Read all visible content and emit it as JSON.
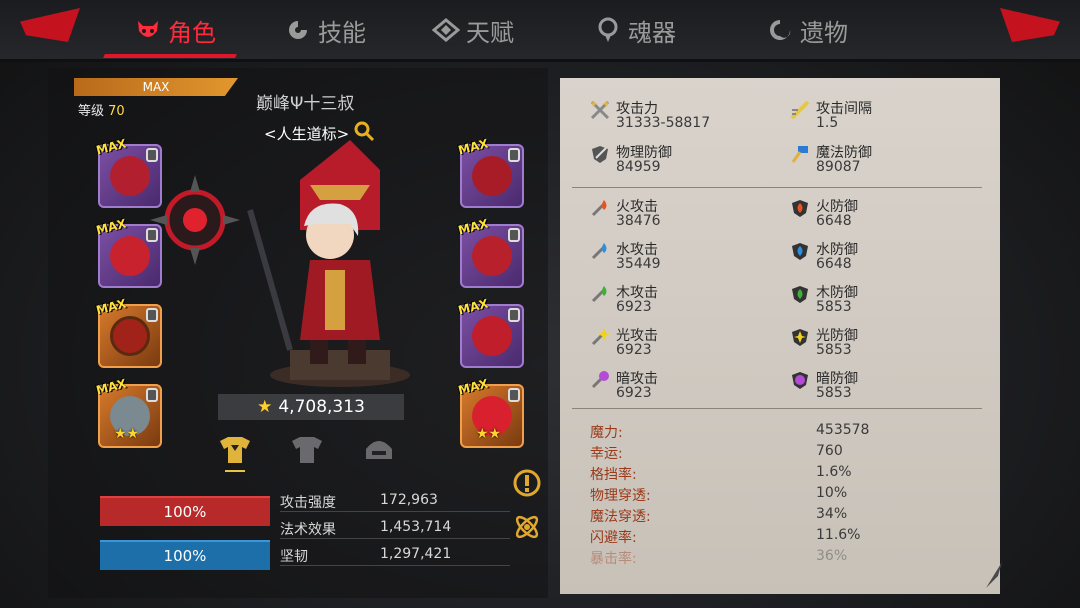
{
  "tabs": [
    {
      "label": "角色",
      "icon": "devil-face-icon",
      "active": true
    },
    {
      "label": "技能",
      "icon": "spiral-skill-icon",
      "active": false
    },
    {
      "label": "天赋",
      "icon": "diamond-talent-icon",
      "active": false
    },
    {
      "label": "魂器",
      "icon": "soul-vessel-icon",
      "active": false
    },
    {
      "label": "遗物",
      "icon": "relic-swirl-icon",
      "active": false
    }
  ],
  "character": {
    "max_label": "MAX",
    "level_label": "等级",
    "level_value": "70",
    "name": "巅峰Ψ十三叔",
    "title": "<人生道标>",
    "power": "4,708,313"
  },
  "equipment": {
    "max_tag": "MAX",
    "left": [
      {
        "name": "weapon-slot",
        "stars": ""
      },
      {
        "name": "glove-slot",
        "stars": ""
      },
      {
        "name": "ring-slot",
        "stars": ""
      },
      {
        "name": "robot-pet-slot",
        "stars": "★★"
      }
    ],
    "right": [
      {
        "name": "helmet-slot",
        "stars": ""
      },
      {
        "name": "armor-slot",
        "stars": ""
      },
      {
        "name": "boots-slot",
        "stars": ""
      },
      {
        "name": "shard-slot",
        "stars": "★★"
      }
    ]
  },
  "bars": {
    "hp": "100%",
    "mp": "100%"
  },
  "substats": [
    {
      "label": "攻击强度",
      "value": "172,963"
    },
    {
      "label": "法术效果",
      "value": "1,453,714"
    },
    {
      "label": "坚韧",
      "value": "1,297,421"
    }
  ],
  "stats_main": [
    {
      "label": "攻击力",
      "value": "31333-58817",
      "icon": "swords-icon"
    },
    {
      "label": "攻击间隔",
      "value": "1.5",
      "icon": "speed-sword-icon"
    },
    {
      "label": "物理防御",
      "value": "84959",
      "icon": "shield-sword-icon"
    },
    {
      "label": "魔法防御",
      "value": "89087",
      "icon": "magic-hammer-icon"
    }
  ],
  "stats_element": [
    {
      "label": "火攻击",
      "value": "38476",
      "color": "#e8531f"
    },
    {
      "label": "火防御",
      "value": "6648",
      "color": "#e8531f"
    },
    {
      "label": "水攻击",
      "value": "35449",
      "color": "#2e8fe0"
    },
    {
      "label": "水防御",
      "value": "6648",
      "color": "#2e8fe0"
    },
    {
      "label": "木攻击",
      "value": "6923",
      "color": "#3fb03a"
    },
    {
      "label": "木防御",
      "value": "5853",
      "color": "#3fb03a"
    },
    {
      "label": "光攻击",
      "value": "6923",
      "color": "#f1d21c"
    },
    {
      "label": "光防御",
      "value": "5853",
      "color": "#f1d21c"
    },
    {
      "label": "暗攻击",
      "value": "6923",
      "color": "#b54ad6"
    },
    {
      "label": "暗防御",
      "value": "5853",
      "color": "#b54ad6"
    }
  ],
  "stats_misc": [
    {
      "label": "魔力:",
      "value": "453578"
    },
    {
      "label": "幸运:",
      "value": "760"
    },
    {
      "label": "格挡率:",
      "value": "1.6%"
    },
    {
      "label": "物理穿透:",
      "value": "10%"
    },
    {
      "label": "魔法穿透:",
      "value": "34%"
    },
    {
      "label": "闪避率:",
      "value": "11.6%"
    },
    {
      "label": "暴击率:",
      "value": "36%"
    }
  ],
  "colors": {
    "accent_red": "#e0162a",
    "hp_bar": "#b82a2a",
    "mp_bar": "#1c6fa8",
    "gold": "#ffcf2a"
  }
}
